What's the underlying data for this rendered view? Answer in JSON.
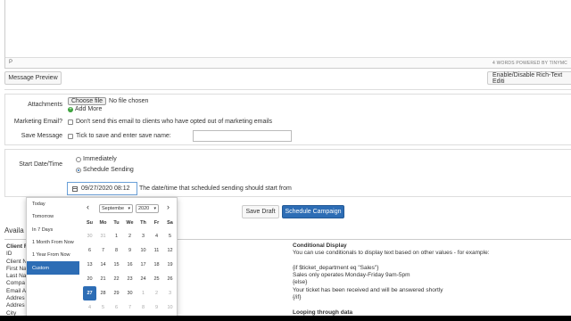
{
  "editor": {
    "path": "P",
    "count": "4 WORDS POWERED BY TINYMC"
  },
  "toolbar": {
    "preview_label": "Message Preview",
    "toggle_label": "Enable/Disable Rich-Text Editi"
  },
  "attachments": {
    "label": "Attachments",
    "button": "Choose file",
    "status": "No file chosen",
    "add_more": "Add More"
  },
  "marketing": {
    "label": "Marketing Email?",
    "text": "Don't send this email to clients who have opted out of marketing emails"
  },
  "save_message": {
    "label": "Save Message",
    "text": "Tick to save and enter save name:"
  },
  "schedule": {
    "label": "Start Date/Time",
    "immediately": "Immediately",
    "schedule_sending": "Schedule Sending",
    "selected": "schedule_sending",
    "date_value": "09/27/2020 08:12",
    "hint": "The date/time that scheduled sending should start from"
  },
  "actions": {
    "save_draft": "Save Draft",
    "schedule_campaign": "Schedule Campaign"
  },
  "variables": {
    "heading": "Availa",
    "left": [
      "Client F",
      "ID",
      "Client N",
      "First Na",
      "Last Na",
      "Compa",
      "Email A",
      "Addres",
      "Addres",
      "City"
    ],
    "right_title": "Conditional Display",
    "right_desc": "You can use conditionals to display text based on other values - for example:",
    "right_code": [
      "{if $ticket_department eq \"Sales\"}",
      "Sales only operates Monday-Friday 9am-5pm",
      "{else}",
      "Your ticket has been received and will be answered shortly",
      "{/if}"
    ],
    "right_next": "Looping through data"
  },
  "picker": {
    "ranges": [
      "Today",
      "Tomorrow",
      "In 7 Days",
      "1 Month From Now",
      "1 Year From Now",
      "Custom"
    ],
    "active_range": "Custom",
    "month": "Septembe",
    "year": "2020",
    "prev": "‹",
    "next": "›",
    "weekdays": [
      "Su",
      "Mo",
      "Tu",
      "We",
      "Th",
      "Fr",
      "Sa"
    ],
    "weeks": [
      [
        "30",
        "31",
        "1",
        "2",
        "3",
        "4",
        "5"
      ],
      [
        "6",
        "7",
        "8",
        "9",
        "10",
        "11",
        "12"
      ],
      [
        "13",
        "14",
        "15",
        "16",
        "17",
        "18",
        "19"
      ],
      [
        "20",
        "21",
        "22",
        "23",
        "24",
        "25",
        "26"
      ],
      [
        "27",
        "28",
        "29",
        "30",
        "1",
        "2",
        "3"
      ],
      [
        "4",
        "5",
        "6",
        "7",
        "8",
        "9",
        "10"
      ]
    ],
    "off_days": {
      "0": [
        0,
        1
      ],
      "4": [
        4,
        5,
        6
      ],
      "5": [
        0,
        1,
        2,
        3,
        4,
        5,
        6
      ]
    },
    "selected_day": "27"
  },
  "colors": {
    "primary": "#2d6db5",
    "border": "#cccccc"
  }
}
